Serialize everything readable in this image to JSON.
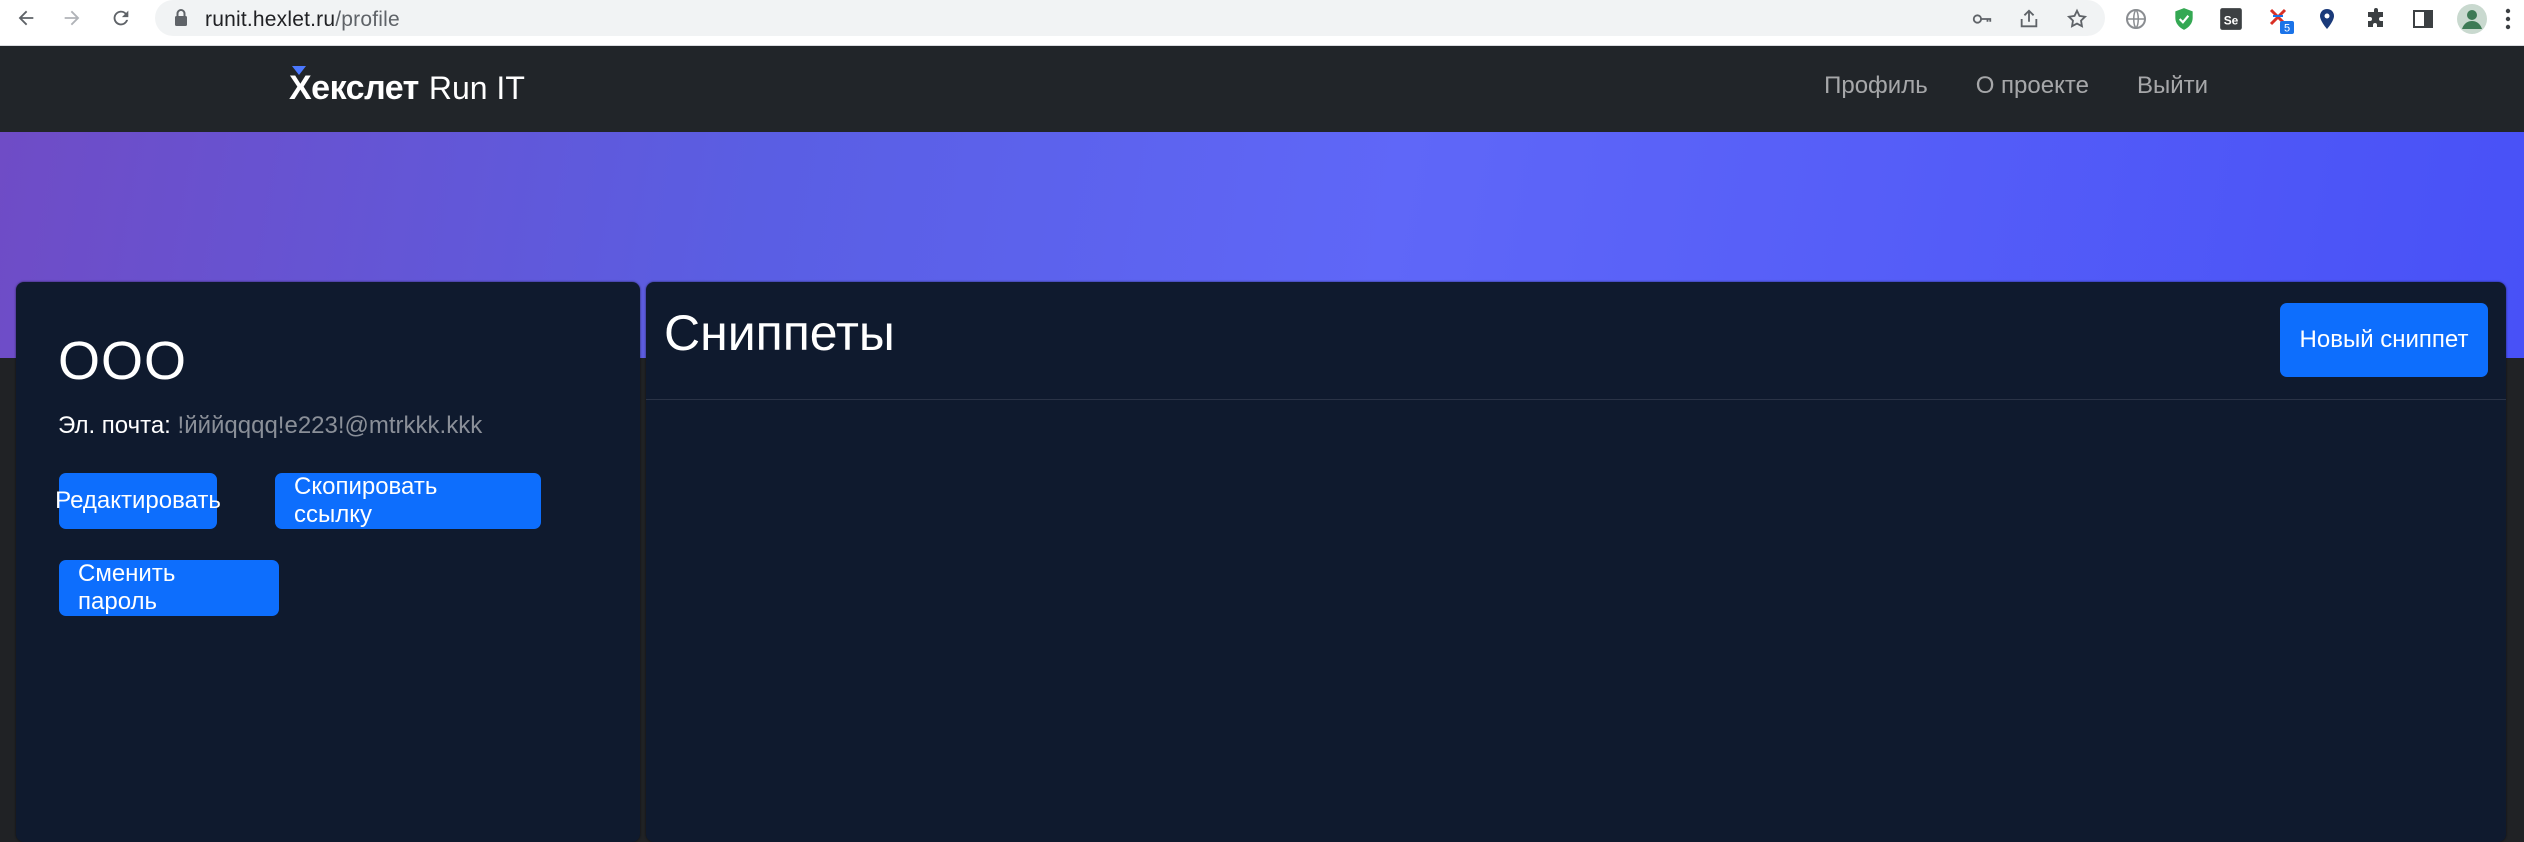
{
  "browser": {
    "url_host": "runit.hexlet.ru",
    "url_path": "/profile",
    "extension_badge": "5"
  },
  "navbar": {
    "brand_main": "Хекслет",
    "brand_sub": "Run IT",
    "links": [
      "Профиль",
      "О проекте",
      "Выйти"
    ]
  },
  "profile": {
    "name": "ООО",
    "email_label": "Эл. почта:",
    "email_value": "!йййqqqq!e223!@mtrkkk.kkk",
    "edit_button": "Редактировать",
    "copy_link_button": "Скопировать ссылку",
    "change_password_button": "Сменить пароль"
  },
  "snippets": {
    "title": "Сниппеты",
    "new_button": "Новый сниппет"
  },
  "colors": {
    "primary": "#0d6efd",
    "navbar": "#212529",
    "card": "#0f1a2e",
    "hero_start": "#6f4cc6",
    "hero_end": "#4851f7"
  }
}
